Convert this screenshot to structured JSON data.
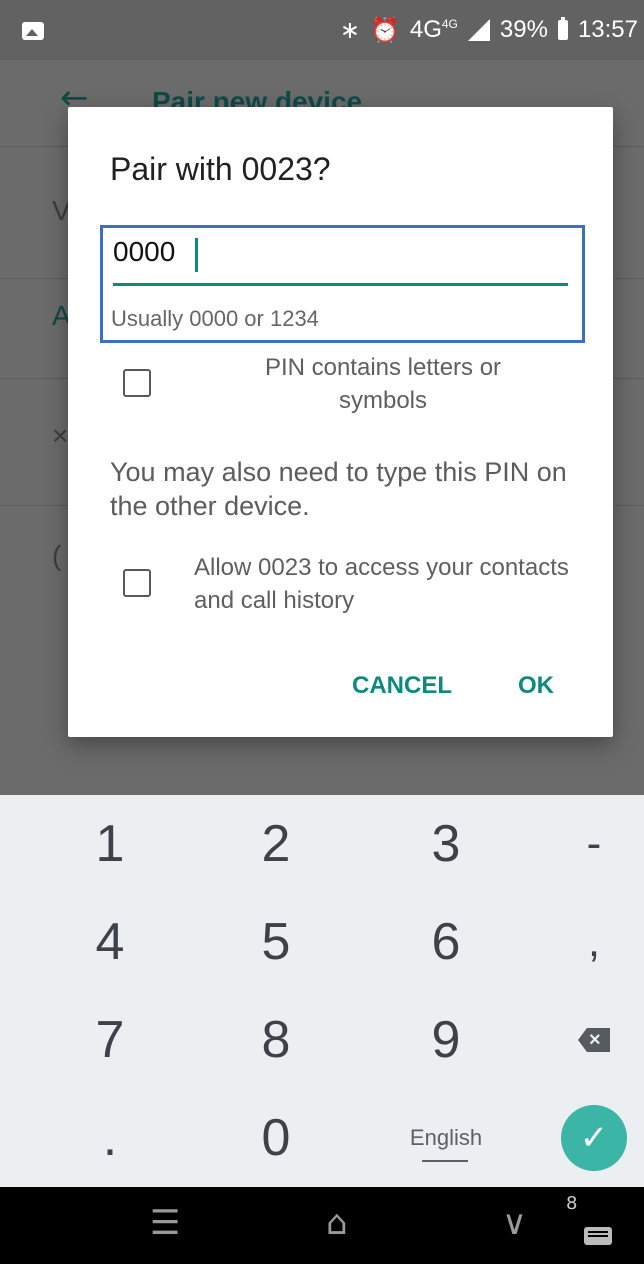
{
  "status_bar": {
    "icons": [
      "image-notification-icon",
      "bluetooth-icon",
      "alarm-icon",
      "signal-icon",
      "battery-icon"
    ],
    "bluetooth_symbol": "∗",
    "alarm_symbol": "⏰",
    "network": "4G",
    "network_sup": "4G",
    "battery": "39%",
    "time": "13:57"
  },
  "background_app": {
    "title": "Pair new device",
    "back_symbol": "←"
  },
  "dialog": {
    "title": "Pair with 0023?",
    "pin_value": "0000",
    "pin_hint": "Usually 0000 or 1234",
    "checkbox_pin_letters_label": "PIN contains letters or symbols",
    "checkbox_pin_letters_checked": false,
    "note": "You may also need to type this PIN on the other device.",
    "checkbox_contacts_label": "Allow 0023 to access your contacts and call history",
    "checkbox_contacts_checked": false,
    "cancel_label": "CANCEL",
    "ok_label": "OK",
    "accent_color": "#0b8a7d"
  },
  "keyboard": {
    "row1": [
      "1",
      "2",
      "3",
      "-"
    ],
    "row2": [
      "4",
      "5",
      "6",
      ","
    ],
    "row3": [
      "7",
      "8",
      "9"
    ],
    "backspace_symbol": "×",
    "row4": [
      ".",
      "0",
      "English"
    ],
    "enter_symbol": "✓"
  },
  "nav_bar": {
    "menu_symbol": "☰",
    "home_symbol": "⌂",
    "back_symbol": "∨",
    "badge": "8"
  }
}
